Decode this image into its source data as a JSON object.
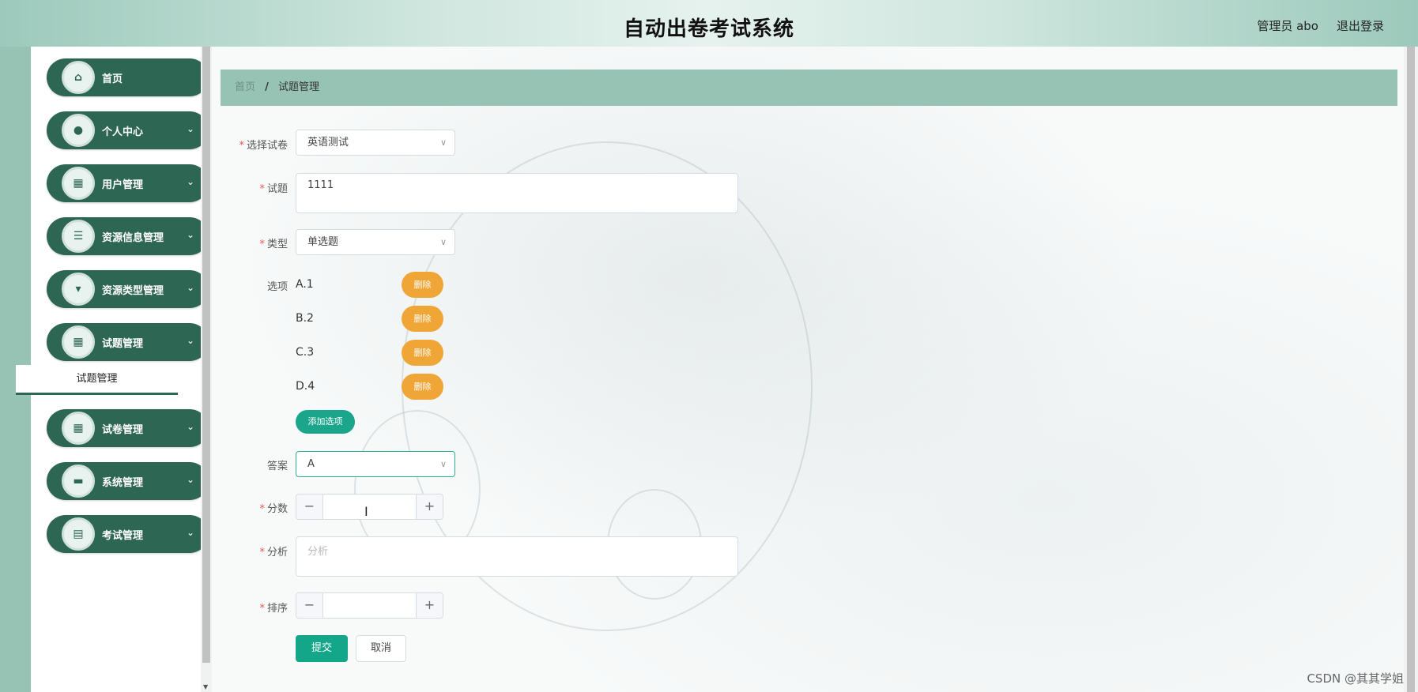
{
  "header": {
    "title": "自动出卷考试系统",
    "user": "管理员 abo",
    "logout": "退出登录"
  },
  "sidebar": {
    "items": [
      {
        "label": "首页",
        "icon": "home-icon"
      },
      {
        "label": "个人中心",
        "icon": "user-icon"
      },
      {
        "label": "用户管理",
        "icon": "grid-icon"
      },
      {
        "label": "资源信息管理",
        "icon": "list-icon"
      },
      {
        "label": "资源类型管理",
        "icon": "brush-icon"
      },
      {
        "label": "试题管理",
        "icon": "grid-icon"
      },
      {
        "label": "试卷管理",
        "icon": "grid-icon"
      },
      {
        "label": "系统管理",
        "icon": "briefcase-icon"
      },
      {
        "label": "考试管理",
        "icon": "clipboard-icon"
      }
    ],
    "submenu_label": "试题管理"
  },
  "breadcrumb": {
    "home": "首页",
    "separator": "/",
    "current": "试题管理"
  },
  "form": {
    "paper_label": "选择试卷",
    "paper_value": "英语测试",
    "question_label": "试题",
    "question_value": "1111",
    "type_label": "类型",
    "type_value": "单选题",
    "options_label": "选项",
    "options": [
      {
        "text": "A.1",
        "delete_label": "删除"
      },
      {
        "text": "B.2",
        "delete_label": "删除"
      },
      {
        "text": "C.3",
        "delete_label": "删除"
      },
      {
        "text": "D.4",
        "delete_label": "删除"
      }
    ],
    "add_option_label": "添加选项",
    "answer_label": "答案",
    "answer_value": "A",
    "score_label": "分数",
    "score_value": "",
    "analysis_label": "分析",
    "analysis_placeholder": "分析",
    "sort_label": "排序",
    "sort_value": "",
    "stepper_minus": "−",
    "stepper_plus": "+",
    "submit_label": "提交",
    "cancel_label": "取消"
  },
  "watermark": "CSDN @其其学姐"
}
